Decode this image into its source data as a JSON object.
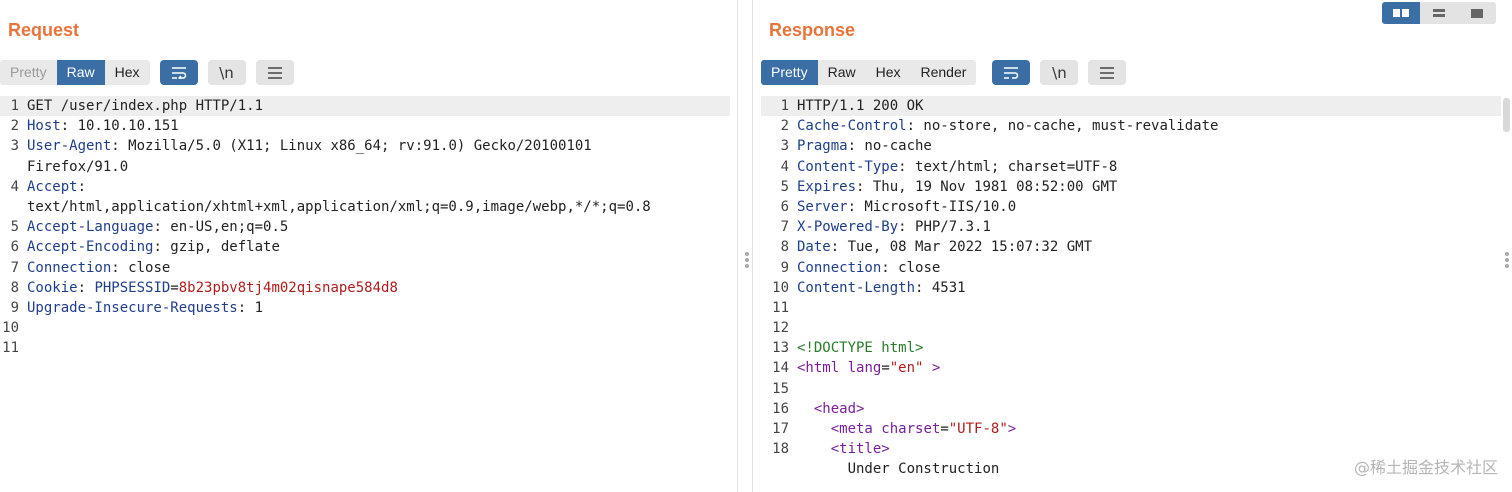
{
  "request": {
    "title": "Request",
    "tabs": [
      "Pretty",
      "Raw",
      "Hex"
    ],
    "tools": {
      "wrap_icon": "wrap-lines-icon",
      "newline": "\\n",
      "menu_icon": "menu-icon"
    },
    "lines": [
      {
        "n": "1",
        "k": "",
        "v": "GET /user/index.php HTTP/1.1"
      },
      {
        "n": "2",
        "k": "Host",
        "v": ": 10.10.10.151"
      },
      {
        "n": "3",
        "k": "User-Agent",
        "v": ": Mozilla/5.0 (X11; Linux x86_64; rv:91.0) Gecko/20100101"
      },
      {
        "n": "",
        "k": "",
        "v": "Firefox/91.0"
      },
      {
        "n": "4",
        "k": "Accept",
        "v": ":"
      },
      {
        "n": "",
        "k": "",
        "v": "text/html,application/xhtml+xml,application/xml;q=0.9,image/webp,*/*;q=0.8"
      },
      {
        "n": "5",
        "k": "Accept-Language",
        "v": ": en-US,en;q=0.5"
      },
      {
        "n": "6",
        "k": "Accept-Encoding",
        "v": ": gzip, deflate"
      },
      {
        "n": "7",
        "k": "Connection",
        "v": ": close"
      },
      {
        "n": "8",
        "k": "Cookie",
        "v": ": "
      },
      {
        "n": "9",
        "k": "Upgrade-Insecure-Requests",
        "v": ": 1"
      },
      {
        "n": "10",
        "k": "",
        "v": ""
      },
      {
        "n": "11",
        "k": "",
        "v": ""
      }
    ],
    "cookie_name": "PHPSESSID",
    "cookie_value": "8b23pbv8tj4m02qisnape584d8"
  },
  "response": {
    "title": "Response",
    "tabs": [
      "Pretty",
      "Raw",
      "Hex",
      "Render"
    ],
    "lines": [
      {
        "n": "1",
        "k": "",
        "v": "HTTP/1.1 200 OK"
      },
      {
        "n": "2",
        "k": "Cache-Control",
        "v": ": no-store, no-cache, must-revalidate"
      },
      {
        "n": "3",
        "k": "Pragma",
        "v": ": no-cache"
      },
      {
        "n": "4",
        "k": "Content-Type",
        "v": ": text/html; charset=UTF-8"
      },
      {
        "n": "5",
        "k": "Expires",
        "v": ": Thu, 19 Nov 1981 08:52:00 GMT"
      },
      {
        "n": "6",
        "k": "Server",
        "v": ": Microsoft-IIS/10.0"
      },
      {
        "n": "7",
        "k": "X-Powered-By",
        "v": ": PHP/7.3.1"
      },
      {
        "n": "8",
        "k": "Date",
        "v": ": Tue, 08 Mar 2022 15:07:32 GMT"
      },
      {
        "n": "9",
        "k": "Connection",
        "v": ": close"
      },
      {
        "n": "10",
        "k": "Content-Length",
        "v": ": 4531"
      },
      {
        "n": "11",
        "k": "",
        "v": ""
      },
      {
        "n": "12",
        "k": "",
        "v": ""
      }
    ],
    "html_lines": [
      {
        "n": "13",
        "doctype": "<!DOCTYPE html>"
      },
      {
        "n": "14",
        "tag": "<html",
        "attr": " lang",
        "eq": "=",
        "str": "\"en\"",
        "end": " >"
      },
      {
        "n": "15"
      },
      {
        "n": "16",
        "indent": "  ",
        "tag": "<head>"
      },
      {
        "n": "17",
        "indent": "    ",
        "tag": "<meta",
        "attr": " charset",
        "eq": "=",
        "str": "\"UTF-8\"",
        "end": ">"
      },
      {
        "n": "18",
        "indent": "    ",
        "tag": "<title>"
      },
      {
        "n": "",
        "indent": "      ",
        "text": "Under Construction"
      }
    ]
  },
  "watermark": "@稀土掘金技术社区",
  "colors": {
    "accent": "#3a6ea5",
    "title": "#e8743b",
    "header_key": "#1f3e8a",
    "cookie_value": "#b01c1c"
  }
}
